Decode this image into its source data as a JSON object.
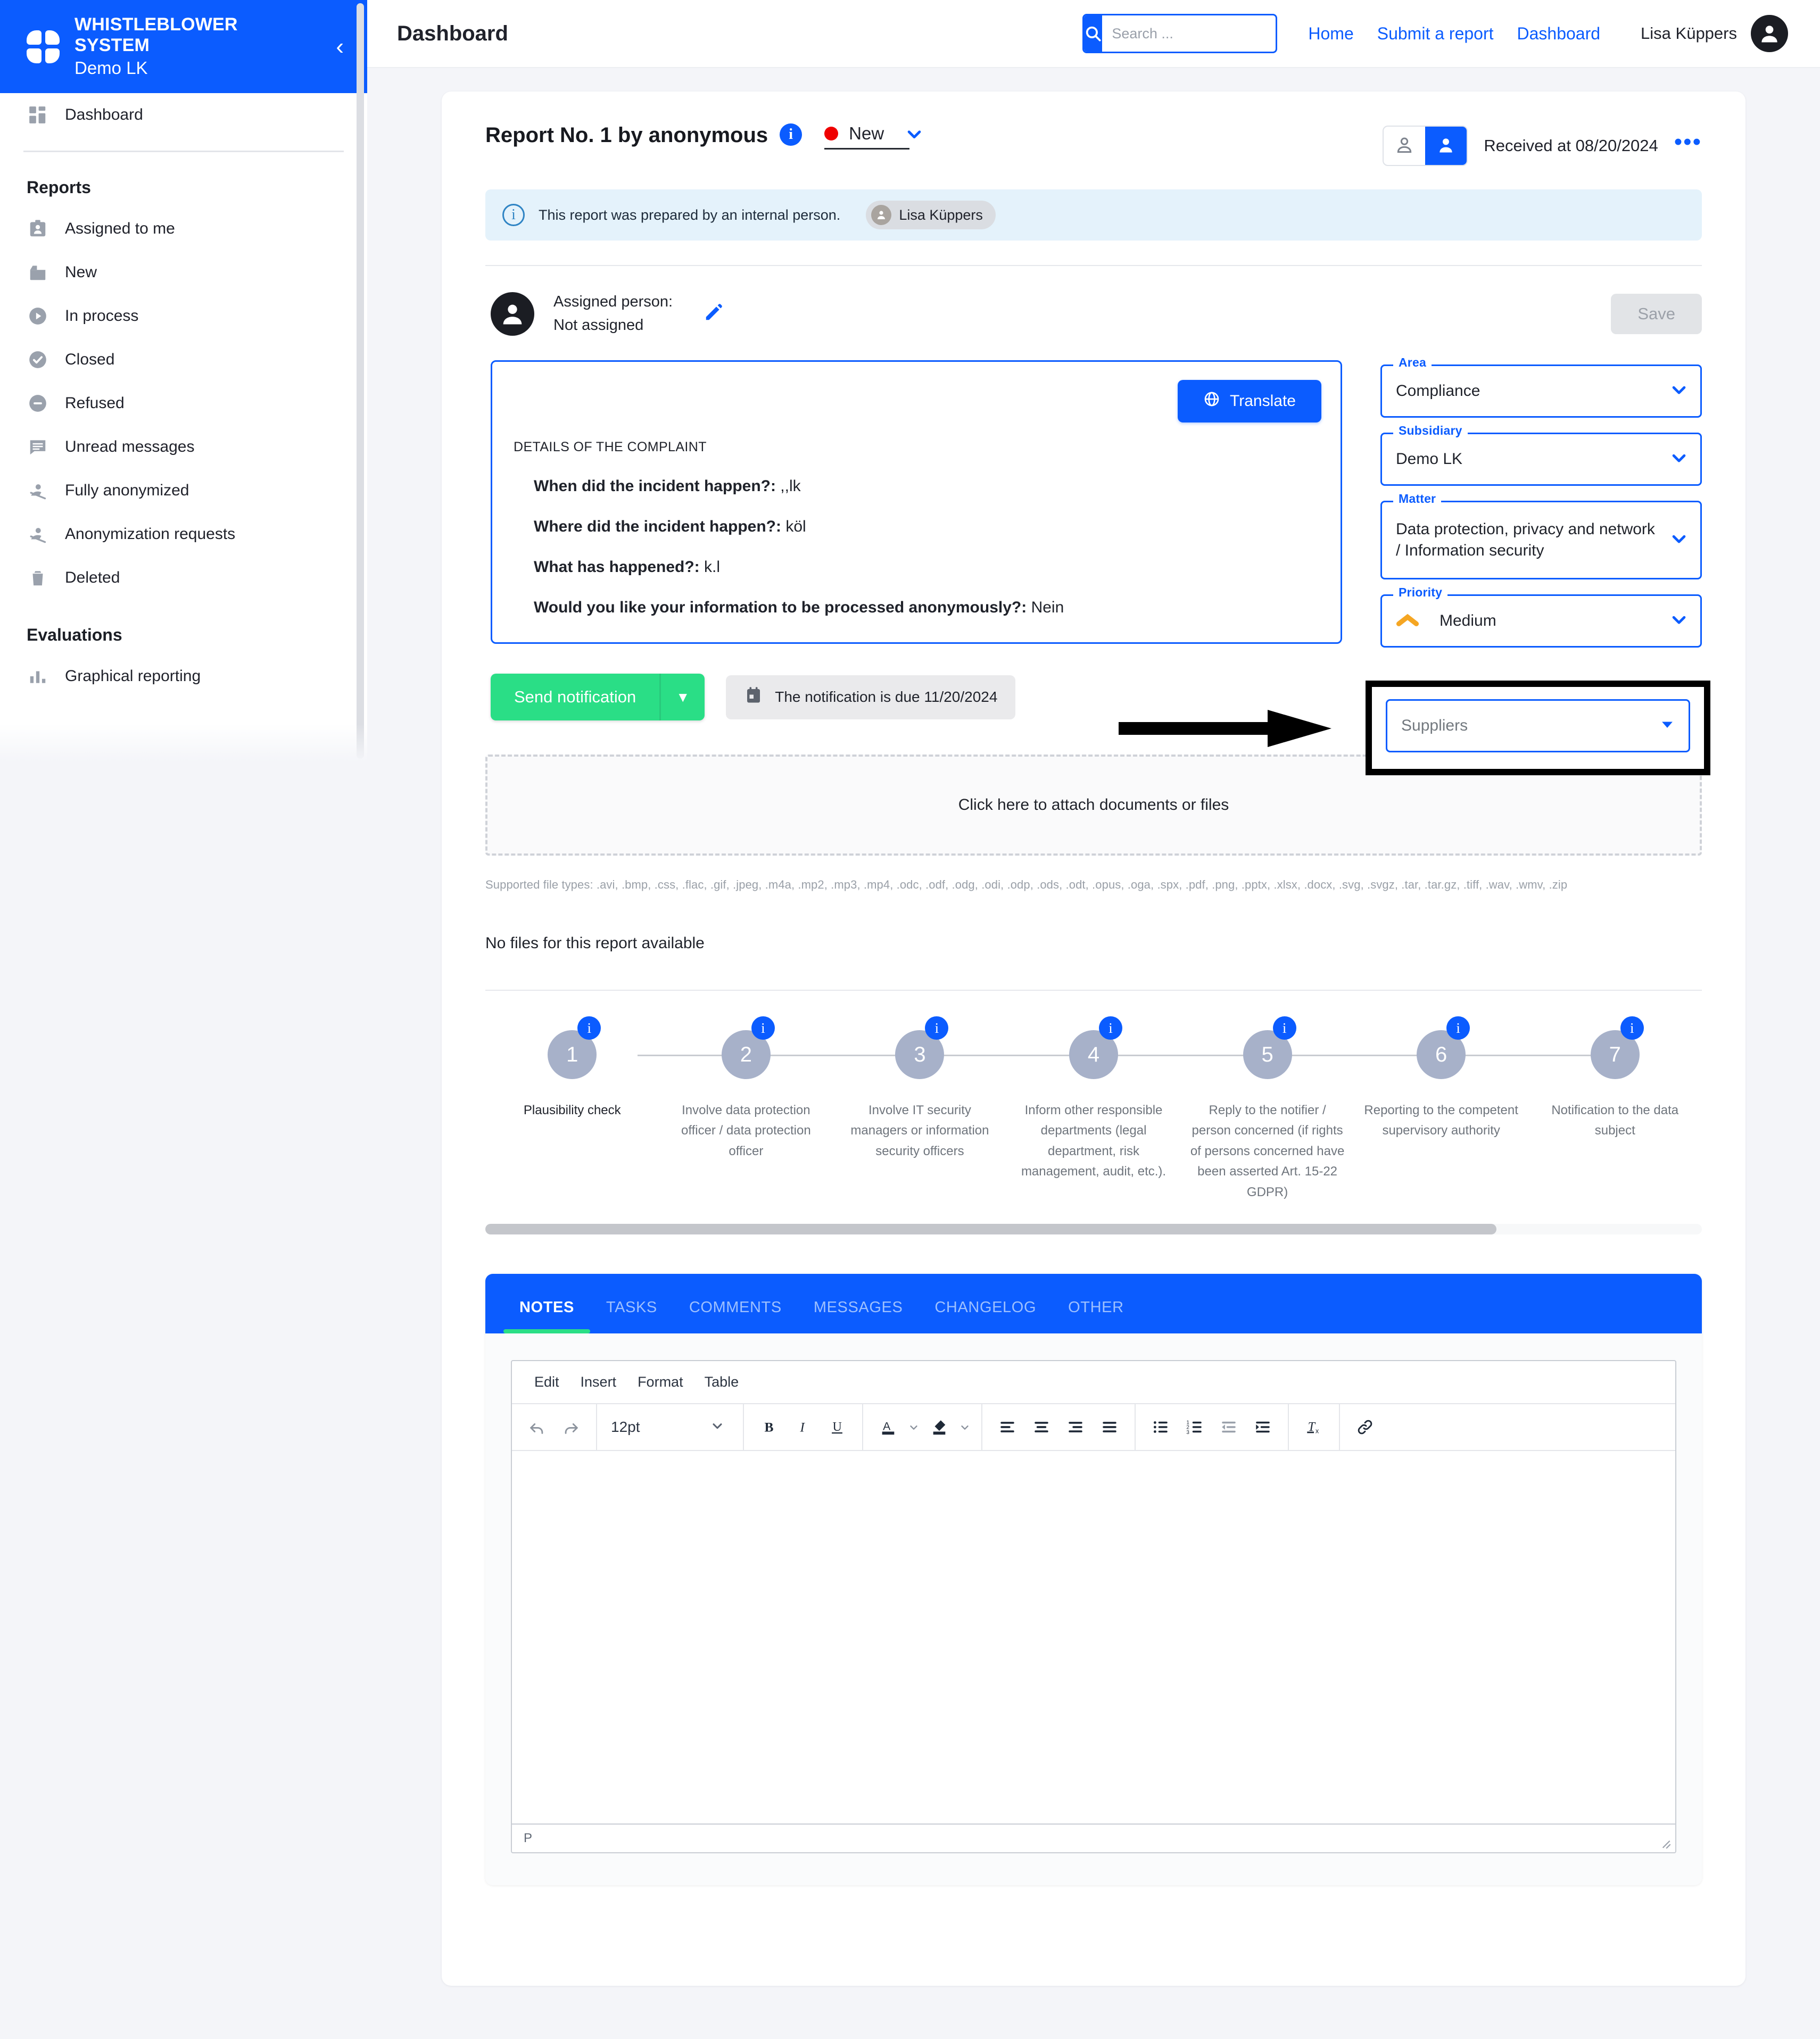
{
  "sidebar": {
    "brand_title": "WHISTLEBLOWER SYSTEM",
    "brand_subtitle": "Demo LK",
    "collapse_icon": "chevron-left-icon",
    "dashboard_item": "Dashboard",
    "sections": [
      {
        "title": "Reports",
        "items": [
          {
            "label": "Assigned to me",
            "icon": "badge-person-icon"
          },
          {
            "label": "New",
            "icon": "inbox-icon"
          },
          {
            "label": "In process",
            "icon": "play-circle-icon"
          },
          {
            "label": "Closed",
            "icon": "check-circle-icon"
          },
          {
            "label": "Refused",
            "icon": "minus-circle-icon"
          },
          {
            "label": "Unread messages",
            "icon": "message-icon"
          },
          {
            "label": "Fully anonymized",
            "icon": "person-off-icon"
          },
          {
            "label": "Anonymization requests",
            "icon": "person-off-icon"
          },
          {
            "label": "Deleted",
            "icon": "trash-icon"
          }
        ]
      },
      {
        "title": "Evaluations",
        "items": [
          {
            "label": "Graphical reporting",
            "icon": "bar-chart-icon"
          }
        ]
      }
    ]
  },
  "topbar": {
    "title": "Dashboard",
    "search_placeholder": "Search ...",
    "search_value": "",
    "search_icon": "search-icon",
    "links": [
      "Home",
      "Submit a report",
      "Dashboard"
    ],
    "user_name": "Lisa Küppers",
    "avatar_icon": "user-avatar-icon"
  },
  "report": {
    "title": "Report No. 1 by anonymous",
    "info_icon": "info-icon",
    "status": {
      "label": "New",
      "dot_color": "#ef0000",
      "chevron": "chevron-down-icon"
    },
    "person_toggle": {
      "anonymous_icon": "person-outline-icon",
      "identified_icon": "person-filled-icon",
      "active": "identified"
    },
    "received_text": "Received at 08/20/2024",
    "more_icon": "ellipsis-icon",
    "banner": {
      "icon": "info-circle-icon",
      "text": "This report was prepared by an internal person.",
      "person_chip": "Lisa Küppers",
      "person_chip_icon": "person-icon"
    },
    "assigned": {
      "avatar_icon": "user-avatar-icon",
      "line1": "Assigned person:",
      "line2": "Not assigned",
      "edit_icon": "pencil-icon"
    },
    "save_label": "Save",
    "translate_label": "Translate",
    "translate_icon": "globe-icon",
    "complaint_heading": "DETAILS OF THE COMPLAINT",
    "complaint_items": [
      {
        "question": "When did the incident happen?:",
        "answer": " ,,lk"
      },
      {
        "question": "Where did the incident happen?:",
        "answer": " köl"
      },
      {
        "question": "What has happened?:",
        "answer": " k.l"
      },
      {
        "question": "Would you like your information to be processed anonymously?:",
        "answer": " Nein"
      }
    ],
    "send_notification_label": "Send notification",
    "send_notification_caret": "caret-down-icon",
    "due_icon": "calendar-icon",
    "due_text": "The notification is due 11/20/2024",
    "fields": [
      {
        "label": "Area",
        "value": "Compliance",
        "chevron": "chevron-down-icon"
      },
      {
        "label": "Subsidiary",
        "value": "Demo LK",
        "chevron": "chevron-down-icon"
      },
      {
        "label": "Matter",
        "value": "Data protection, privacy and network / Information security",
        "chevron": "chevron-down-icon"
      },
      {
        "label": "Priority",
        "value": "Medium",
        "chevron": "chevron-down-icon",
        "priority_icon": "priority-medium-icon",
        "priority_color": "#f5a623"
      }
    ],
    "suppliers_field": {
      "label": "",
      "value": "Suppliers",
      "chevron": "caret-down-icon",
      "highlighted": true,
      "annotation_icon": "arrow-right-annotation"
    },
    "attach_text": "Click here to attach documents or files",
    "supported_types": "Supported file types: .avi, .bmp, .css, .flac, .gif, .jpeg, .m4a, .mp2, .mp3, .mp4, .odc, .odf, .odg, .odi, .odp, .ods, .odt, .opus, .oga, .spx, .pdf, .png, .pptx, .xlsx, .docx, .svg, .svgz, .tar, .tar.gz, .tiff, .wav, .wmv, .zip",
    "no_files_text": "No files for this report available"
  },
  "steps": [
    {
      "number": "1",
      "label": "Plausibility check",
      "active": true,
      "info_icon": "info-icon"
    },
    {
      "number": "2",
      "label": "Involve data protection officer / data protection officer",
      "active": false,
      "info_icon": "info-icon"
    },
    {
      "number": "3",
      "label": "Involve IT security managers or information security officers",
      "active": false,
      "info_icon": "info-icon"
    },
    {
      "number": "4",
      "label": "Inform other responsible departments (legal department, risk management, audit, etc.).",
      "active": false,
      "info_icon": "info-icon"
    },
    {
      "number": "5",
      "label": "Reply to the notifier / person concerned (if rights of persons concerned have been asserted Art. 15-22 GDPR)",
      "active": false,
      "info_icon": "info-icon"
    },
    {
      "number": "6",
      "label": "Reporting to the competent supervisory authority",
      "active": false,
      "info_icon": "info-icon"
    },
    {
      "number": "7",
      "label": "Notification to the data subject",
      "active": false,
      "info_icon": "info-icon"
    }
  ],
  "tabs": [
    {
      "label": "NOTES",
      "active": true
    },
    {
      "label": "TASKS",
      "active": false
    },
    {
      "label": "COMMENTS",
      "active": false
    },
    {
      "label": "MESSAGES",
      "active": false
    },
    {
      "label": "CHANGELOG",
      "active": false
    },
    {
      "label": "OTHER",
      "active": false
    }
  ],
  "editor": {
    "menu": [
      "Edit",
      "Insert",
      "Format",
      "Table"
    ],
    "font_size": "12pt",
    "buttons": [
      "undo-icon",
      "redo-icon",
      "bold-icon",
      "italic-icon",
      "underline-icon",
      "text-color-icon",
      "highlight-color-icon",
      "align-left-icon",
      "align-center-icon",
      "align-right-icon",
      "align-justify-icon",
      "bullet-list-icon",
      "numbered-list-icon",
      "outdent-icon",
      "indent-icon",
      "clear-formatting-icon",
      "link-icon"
    ],
    "content": "",
    "status_path": "P"
  },
  "colors": {
    "brand_blue": "#0b5cff",
    "accent_green": "#2ade86",
    "status_red": "#ef0000",
    "step_gray": "#a7b1c9",
    "priority_orange": "#f5a623"
  }
}
